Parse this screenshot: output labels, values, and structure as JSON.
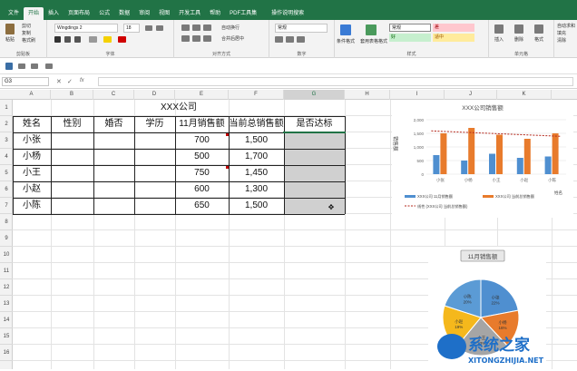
{
  "menu": [
    "文件",
    "开始",
    "插入",
    "页面布局",
    "公式",
    "数据",
    "审阅",
    "视图",
    "开发工具",
    "帮助",
    "PDF工具集",
    "操作说明搜索"
  ],
  "ribbon": {
    "paste": "粘贴",
    "cut": "剪切",
    "copy": "复制",
    "format_painter": "格式刷",
    "clipboard": "剪贴板",
    "font_name": "Wingdings 2",
    "font_size": "18",
    "font_group": "字体",
    "wrap": "自动换行",
    "merge": "合并后居中",
    "align_group": "对齐方式",
    "number_format": "常规",
    "number_group": "数字",
    "cond_format": "条件格式",
    "table_format": "套用表格格式",
    "style_normal": "常规",
    "style_bad": "差",
    "style_good": "好",
    "style_neutral": "适中",
    "styles_group": "样式",
    "insert": "插入",
    "delete": "删除",
    "format": "格式",
    "cells_group": "单元格",
    "autosum": "自动求和",
    "fill": "填充",
    "clear": "清除"
  },
  "namebox": "G3",
  "columns": [
    "A",
    "B",
    "C",
    "D",
    "E",
    "F",
    "G",
    "H",
    "I",
    "J",
    "K"
  ],
  "rows": [
    "1",
    "2",
    "3",
    "4",
    "5",
    "6",
    "7",
    "8",
    "9",
    "10",
    "11",
    "12",
    "13",
    "14",
    "15",
    "16"
  ],
  "sheet": {
    "title": "XXX公司",
    "headers": [
      "姓名",
      "性别",
      "婚否",
      "学历",
      "11月销售额",
      "当前总销售额",
      "是否达标"
    ],
    "data": [
      [
        "小张",
        "",
        "",
        "",
        "700",
        "1,500",
        ""
      ],
      [
        "小杨",
        "",
        "",
        "",
        "500",
        "1,700",
        ""
      ],
      [
        "小王",
        "",
        "",
        "",
        "750",
        "1,450",
        ""
      ],
      [
        "小赵",
        "",
        "",
        "",
        "600",
        "1,300",
        ""
      ],
      [
        "小陈",
        "",
        "",
        "",
        "650",
        "1,500",
        ""
      ]
    ]
  },
  "chart_data": [
    {
      "type": "bar",
      "title": "XXX公司销售额",
      "ylabel": "销售额",
      "xlabel": "姓名",
      "categories": [
        "小张",
        "小杨",
        "小王",
        "小赵",
        "小陈"
      ],
      "ylim": [
        0,
        2000
      ],
      "yticks": [
        "2,000",
        "1,500",
        "1,000",
        "500",
        "0"
      ],
      "series": [
        {
          "name": "XXX公司 11月销售额",
          "values": [
            700,
            500,
            750,
            600,
            650
          ],
          "color": "#4f8fd0"
        },
        {
          "name": "XXX公司 当前总销售额",
          "values": [
            1500,
            1700,
            1450,
            1300,
            1500
          ],
          "color": "#e87b2c"
        }
      ],
      "trend": {
        "name": "线性 (XXX公司 当前总销售额)",
        "color": "#b3271b"
      },
      "legend": "bottom"
    },
    {
      "type": "pie",
      "title": "11月销售额",
      "categories": [
        "小张",
        "小杨",
        "小王",
        "小赵",
        "小陈"
      ],
      "values": [
        22,
        16,
        23,
        19,
        20
      ],
      "labels": [
        "小张 22%",
        "小杨 16%",
        "小王 23%",
        "小赵 19%",
        "小陈 20%"
      ],
      "colors": [
        "#4f8fd0",
        "#e87b2c",
        "#a5a5a5",
        "#f5b81c",
        "#5b9bd5"
      ]
    }
  ],
  "watermark": {
    "line1": "系统之家",
    "line2": "XITONGZHIJIA.NET"
  }
}
